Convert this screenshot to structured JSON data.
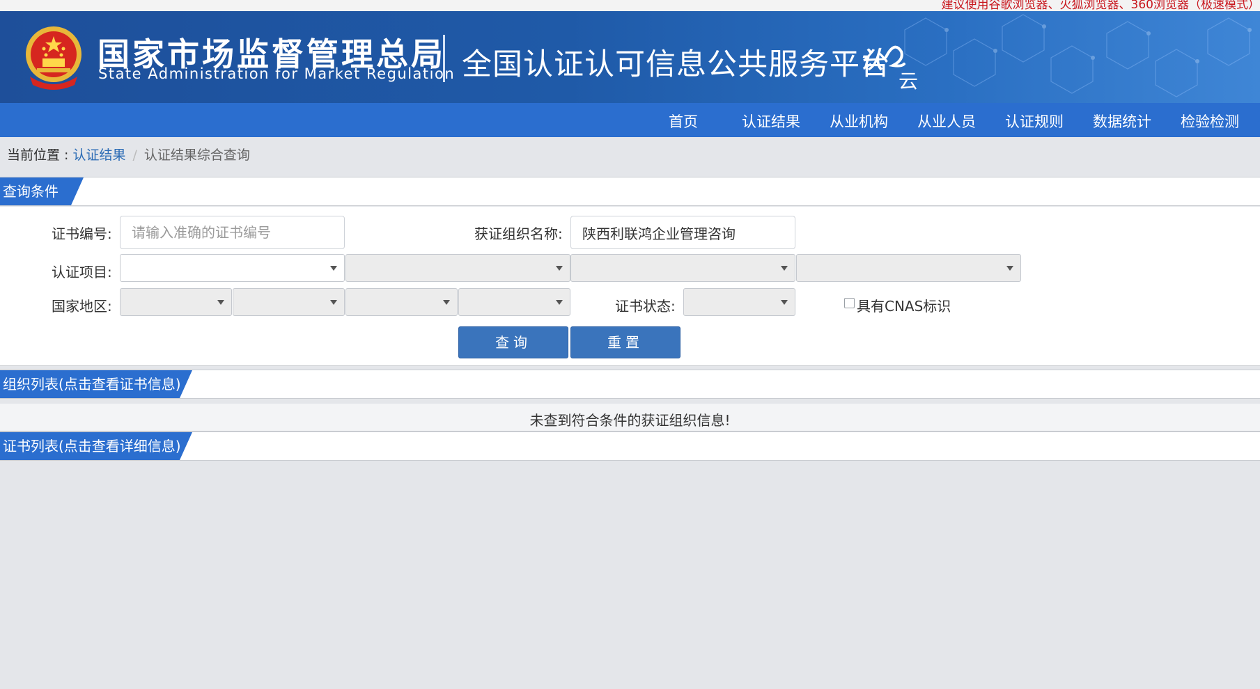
{
  "top_notice": "建议使用谷歌浏览器、火狐浏览器、360浏览器（极速模式）",
  "header": {
    "agency_cn": "国家市场监督管理总局",
    "agency_en": "State Administration  for  Market Regulation",
    "platform_title": "全国认证认可信息公共服务平台",
    "logo_text_1": "认",
    "logo_text_2": "云"
  },
  "nav": {
    "items": [
      "首页",
      "认证结果",
      "从业机构",
      "从业人员",
      "认证规则",
      "数据统计",
      "检验检测"
    ]
  },
  "breadcrumb": {
    "prefix": "当前位置 : ",
    "link": "认证结果",
    "separator": "/",
    "current": "认证结果综合查询"
  },
  "query": {
    "section_title": "查询条件",
    "cert_no_label": "证书编号:",
    "cert_no_placeholder": "请输入准确的证书编号",
    "cert_no_value": "",
    "org_name_label": "获证组织名称:",
    "org_name_value": "陕西利联鸿企业管理咨询",
    "project_label": "认证项目:",
    "region_label": "国家地区:",
    "status_label": "证书状态:",
    "cnas_label": "具有CNAS标识",
    "search_button": "查询",
    "reset_button": "重置"
  },
  "org_list": {
    "section_title": "组织列表(点击查看证书信息)",
    "empty_message": "未查到符合条件的获证组织信息!"
  },
  "cert_list": {
    "section_title": "证书列表(点击查看详细信息)"
  },
  "colors": {
    "banner": "#1f5aa8",
    "nav": "#2b6ecf",
    "button": "#3a74bc",
    "link": "#2c6cb5",
    "notice": "#c8161d"
  }
}
